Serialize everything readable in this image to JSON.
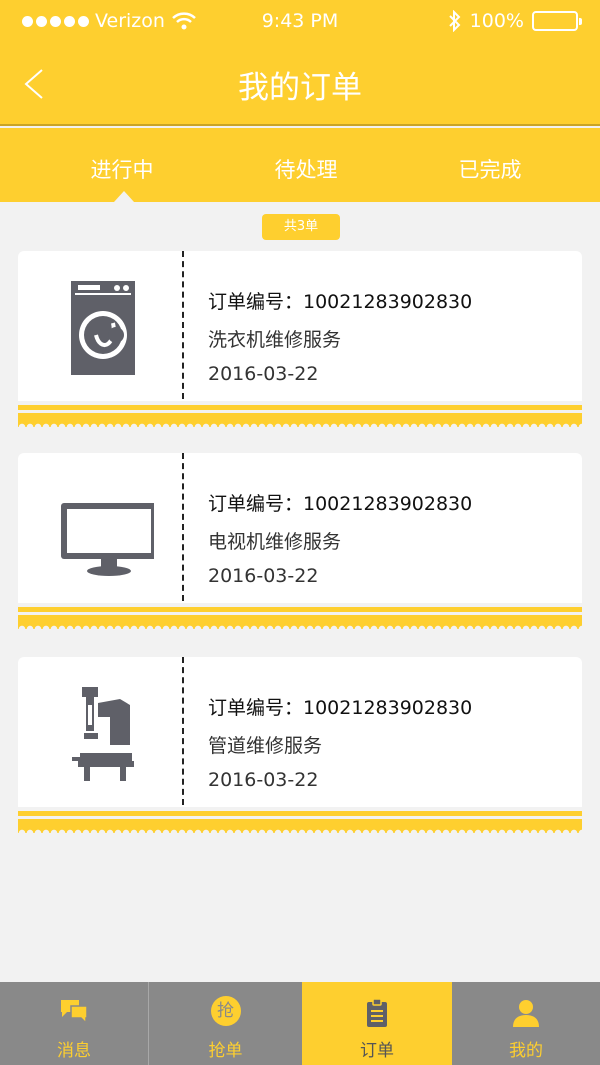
{
  "status_bar": {
    "carrier": "Verizon",
    "time": "9:43 PM",
    "battery": "100%"
  },
  "nav": {
    "back_label": "<",
    "title": "我的订单"
  },
  "tabs": [
    {
      "label": "进行中"
    },
    {
      "label": "待处理"
    },
    {
      "label": "已完成"
    }
  ],
  "count_badge": "共3单",
  "orders": [
    {
      "order_no": "订单编号：10021283902830",
      "service": "洗衣机维修服务",
      "date": "2016-03-22",
      "icon": "washing-machine-icon"
    },
    {
      "order_no": "订单编号：10021283902830",
      "service": "电视机维修服务",
      "date": "2016-03-22",
      "icon": "tv-icon"
    },
    {
      "order_no": "订单编号：10021283902830",
      "service": "管道维修服务",
      "date": "2016-03-22",
      "icon": "drill-press-icon"
    }
  ],
  "tabbar": {
    "items": [
      {
        "label": "消息",
        "icon": "chat-icon"
      },
      {
        "label": "抢单",
        "icon": "grab-icon",
        "icon_text": "抢"
      },
      {
        "label": "订单",
        "icon": "clipboard-icon"
      },
      {
        "label": "我的",
        "icon": "user-icon"
      }
    ]
  },
  "colors": {
    "accent": "#fecf2f",
    "icon_gray": "#5f6068",
    "tabbar_gray": "#898989",
    "background": "#f2f2f2"
  }
}
